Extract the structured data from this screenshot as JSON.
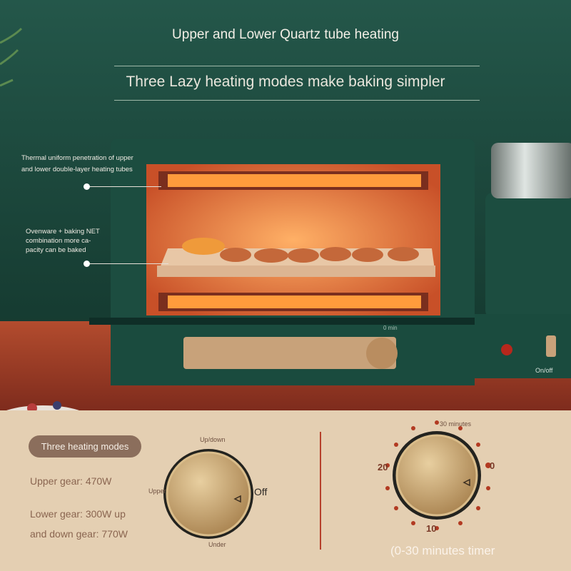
{
  "headline": "Upper and Lower Quartz tube heating",
  "subheadline": "Three Lazy heating modes make baking simpler",
  "callouts": [
    "Thermal uniform penetration of upper",
    "and lower double-layer heating tubes",
    "Ovenware + baking NET",
    "combination more ca-",
    "pacity can be baked"
  ],
  "oven_labels": {
    "timer_zero": "0 min",
    "switch": "On/off"
  },
  "modes": {
    "title": "Three heating modes",
    "upper": "Upper gear: 470W",
    "lower_line1": "Lower gear: 300W up",
    "lower_line2": "and down gear: 770W"
  },
  "mode_dial": {
    "top": "Up/down",
    "left": "Upper",
    "right": "Off",
    "bottom": "Under"
  },
  "timer_dial": {
    "top": "30 minutes",
    "left": "20",
    "right": "0",
    "bottom": "10",
    "caption": "(0-30 minutes timer"
  },
  "colors": {
    "background": "#1f4a3a",
    "panel": "#e4cfb2",
    "accent": "#b6402b",
    "knob": "#c9a877",
    "oven": "#1c4d40"
  }
}
